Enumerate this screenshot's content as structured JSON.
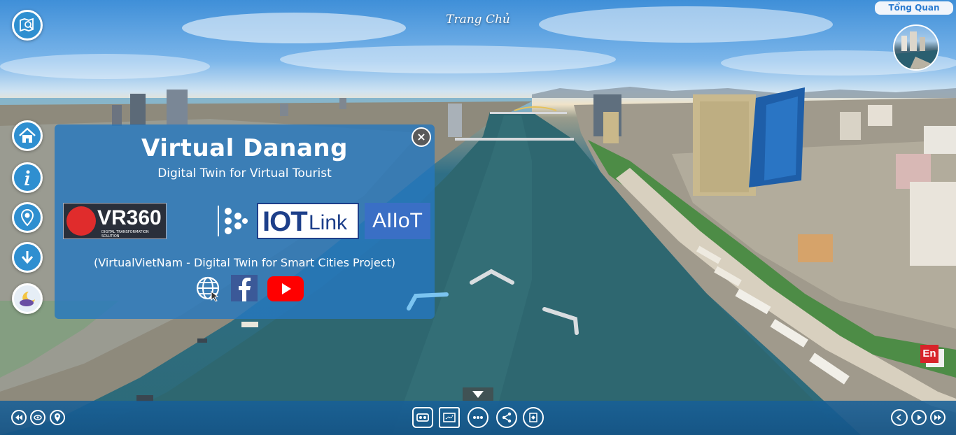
{
  "header": {
    "scene_title": "Trang Chủ",
    "overview_button": "Tổng Quan"
  },
  "panel": {
    "title": "Virtual Danang",
    "subtitle": "Digital Twin for Virtual Tourist",
    "note": "(VirtualVietNam - Digital Twin for Smart Cities Project)",
    "close_glyph": "×",
    "logos": {
      "vr360": "VR360",
      "vr360_tagline": "DIGITAL TRANSFORMATION SOLUTION",
      "iotlink_a": "IOT",
      "iotlink_b": "Link",
      "ailot": "AIIoT"
    }
  },
  "language_button": "En",
  "left_toolbar": [
    {
      "name": "map-search-icon"
    },
    {
      "name": "home-icon"
    },
    {
      "name": "info-icon"
    },
    {
      "name": "location-pin-icon"
    },
    {
      "name": "download-icon"
    },
    {
      "name": "night-mode-icon"
    }
  ],
  "bottom_bar": {
    "left": [
      "rewind-icon",
      "orbit-icon",
      "location-icon"
    ],
    "center": [
      "vr-headset-icon",
      "floorplan-icon",
      "more-icon",
      "share-icon",
      "gyro-icon"
    ],
    "right": [
      "back-icon",
      "play-icon",
      "forward-icon"
    ]
  },
  "colors": {
    "accent": "#2f8fd0",
    "panel": "#2678be",
    "bottom_bar": "#186098",
    "youtube_red": "#ff0000",
    "facebook_blue": "#3b5998"
  }
}
